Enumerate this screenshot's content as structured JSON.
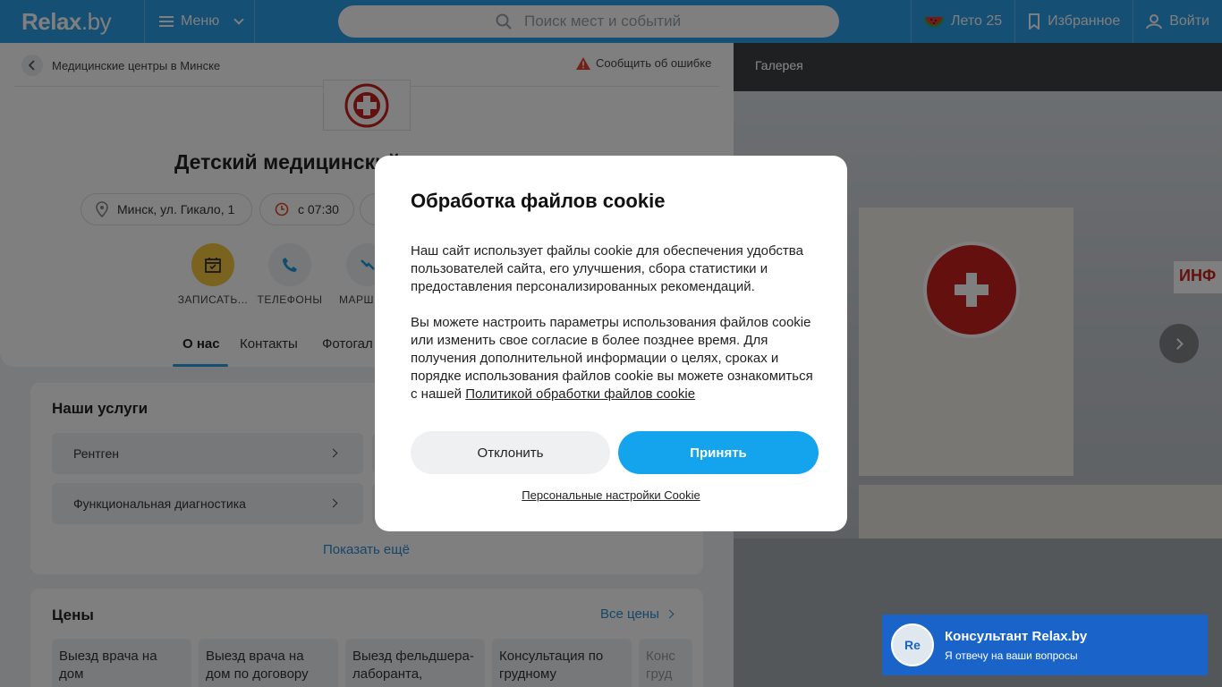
{
  "header": {
    "logo_main": "Relax",
    "logo_suffix": ".by",
    "menu_label": "Меню",
    "search_placeholder": "Поиск мест и событий",
    "summer_label": "Лето 25",
    "favorites_label": "Избранное",
    "login_label": "Войти"
  },
  "page": {
    "breadcrumb": "Медицинские центры в Минске",
    "report_error": "Сообщить об ошибке",
    "title": "Детский медицинский",
    "address": "Минск, ул. Гикало, 1",
    "hours": "с 07:30",
    "actions": [
      {
        "label": "ЗАПИСАТЬ..."
      },
      {
        "label": "ТЕЛЕФОНЫ"
      },
      {
        "label": "МАРШ"
      }
    ],
    "tabs": [
      "О нас",
      "Контакты",
      "Фотогал"
    ]
  },
  "services": {
    "title": "Наши услуги",
    "items": [
      "Рентген",
      "Функциональная диагностика"
    ],
    "show_more": "Показать ещё"
  },
  "prices": {
    "title": "Цены",
    "all_prices": "Все цены",
    "items": [
      "Выезд врача на дом",
      "Выезд врача на дом по договору",
      "Выезд фельдшера-лаборанта,",
      "Консультация по грудному",
      "Конс груд"
    ]
  },
  "gallery": {
    "label": "Галерея",
    "sign_text": "ИНФ"
  },
  "cookie_modal": {
    "title": "Обработка файлов cookie",
    "paragraph1": "Наш сайт использует файлы cookie для обеспечения удобства пользователей сайта, его улучшения, сбора статистики и предоставления персонализированных рекомендаций.",
    "paragraph2": "Вы можете настроить параметры использования файлов cookie или изменить свое согласие в более позднее время. Для получения дополнительной информации о целях, сроках и порядке использования файлов cookie вы можете ознакомиться с нашей",
    "policy_link": "Политикой обработки файлов cookie",
    "decline": "Отклонить",
    "accept": "Принять",
    "settings": "Персональные настройки Cookie"
  },
  "chat": {
    "avatar": "Re",
    "title": "Консультант Relax.by",
    "subtitle": "Я отвечу на ваши вопросы"
  },
  "colors": {
    "brand": "#2a9ee6",
    "accept": "#14a4ee",
    "chat": "#1a64c9"
  }
}
